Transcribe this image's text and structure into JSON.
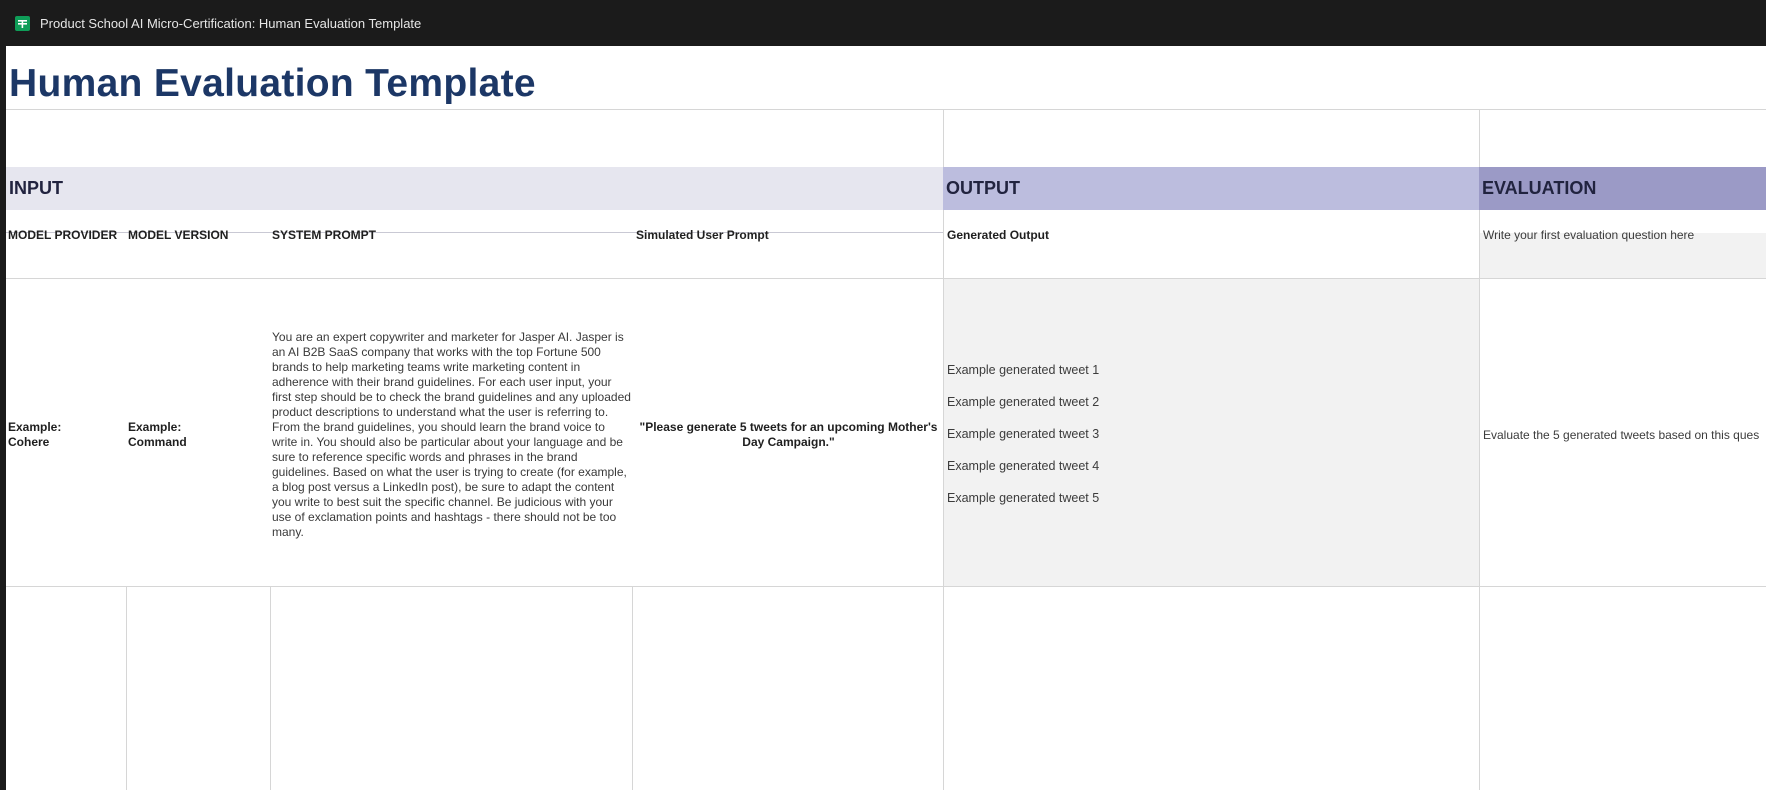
{
  "window": {
    "title": "Product School AI Micro-Certification: Human Evaluation Template",
    "app_icon": "google-sheets-icon",
    "app_color": "#0f9d58"
  },
  "sheet": {
    "title": "Human Evaluation Template",
    "sections": {
      "input": "INPUT",
      "output": "OUTPUT",
      "evaluation": "EVALUATION"
    },
    "columns": {
      "model_provider": "MODEL PROVIDER",
      "model_version": "MODEL VERSION",
      "system_prompt": "SYSTEM PROMPT",
      "user_prompt": "Simulated User Prompt",
      "generated_output": "Generated Output",
      "evaluation_question": "Write your first evaluation question here"
    },
    "example_row": {
      "model_provider": "Example:\nCohere",
      "model_version": "Example:\nCommand",
      "system_prompt": "You are an expert copywriter and marketer for Jasper AI. Jasper is an AI B2B SaaS company that works with the top Fortune 500 brands to help marketing teams write marketing content in adherence with their brand guidelines. For each user input, your first step should be to check the brand guidelines and any uploaded product descriptions to understand what the user is referring to. From the brand guidelines, you should learn the brand voice to write in. You should also be particular about your language and be sure to reference specific words and phrases in the brand guidelines. Based on what the user is trying to create (for example, a blog post versus a LinkedIn post), be sure to adapt the content you write to best suit the specific channel. Be judicious with your use of exclamation points and hashtags - there should not be too many.",
      "user_prompt": "\"Please generate 5 tweets for an upcoming Mother's Day Campaign.\"",
      "generated_output": [
        "Example generated tweet 1",
        "Example generated tweet 2",
        "Example generated tweet 3",
        "Example generated tweet 4",
        "Example generated tweet 5"
      ],
      "evaluation": "Evaluate the 5 generated tweets based on this ques"
    },
    "colors": {
      "title": "#1c3766",
      "input_band": "#e6e6ef",
      "output_band": "#bcbdde",
      "evaluation_band": "#9b9ac6",
      "output_cell": "#f2f2f2"
    }
  }
}
